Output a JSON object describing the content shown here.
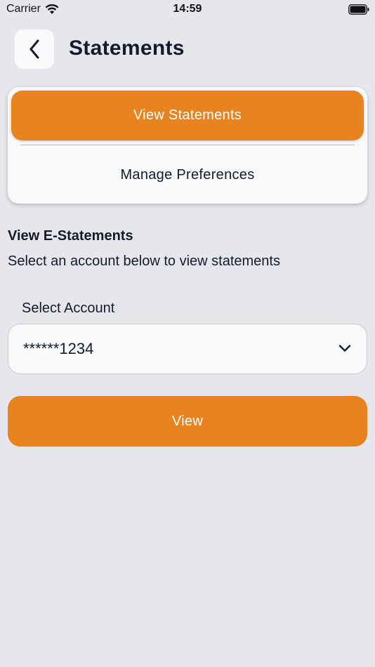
{
  "status_bar": {
    "carrier": "Carrier",
    "time": "14:59"
  },
  "header": {
    "title": "Statements",
    "back_icon": "chevron-left-icon"
  },
  "tabs": [
    {
      "label": "View Statements",
      "active": true
    },
    {
      "label": "Manage Preferences",
      "active": false
    }
  ],
  "section": {
    "title": "View E-Statements",
    "subtitle": "Select an account below to view statements"
  },
  "account_select": {
    "label": "Select Account",
    "value": "******1234"
  },
  "view_button": {
    "label": "View"
  },
  "colors": {
    "accent": "#e8841f",
    "background": "#e6e7ec",
    "card": "#f8f9fb",
    "text": "#141b2b"
  }
}
